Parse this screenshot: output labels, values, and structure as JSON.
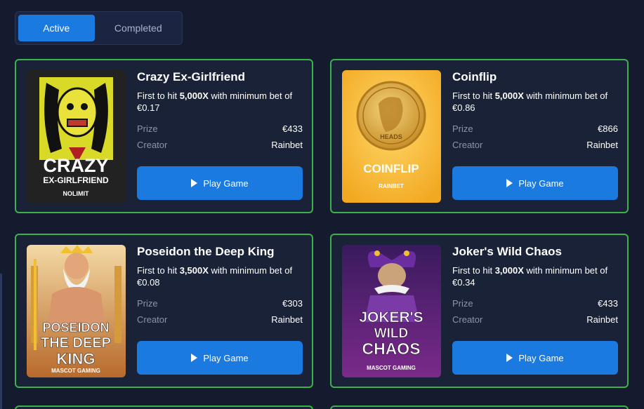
{
  "tabs": {
    "active": "Active",
    "completed": "Completed"
  },
  "labels": {
    "prize": "Prize",
    "creator": "Creator",
    "play": "Play Game"
  },
  "colors": {
    "accent": "#1a7ae0",
    "card_border": "#3db24a",
    "background": "#141b2e",
    "card_bg": "#1a2238"
  },
  "cards": [
    {
      "title": "Crazy Ex-Girlfriend",
      "desc_pre": "First to hit ",
      "multiplier": "5,000X",
      "desc_mid": " with minimum bet of ",
      "min_bet": "€0.17",
      "prize": "€433",
      "creator": "Rainbet",
      "thumb": {
        "line1": "CRAZY",
        "line2": "EX-GIRLFRIEND",
        "provider": "NOLIMIT"
      }
    },
    {
      "title": "Coinflip",
      "desc_pre": "First to hit ",
      "multiplier": "5,000X",
      "desc_mid": " with minimum bet of ",
      "min_bet": "€0.86",
      "prize": "€866",
      "creator": "Rainbet",
      "thumb": {
        "line1": "COINFLIP",
        "coin_text": "HEADS",
        "provider": "RAINBET"
      }
    },
    {
      "title": "Poseidon the Deep King",
      "desc_pre": "First to hit ",
      "multiplier": "3,500X",
      "desc_mid": " with minimum bet of ",
      "min_bet": "€0.08",
      "prize": "€303",
      "creator": "Rainbet",
      "thumb": {
        "line1": "POSEIDON",
        "line2": "THE DEEP",
        "line3": "KING",
        "provider": "MASCOT GAMING"
      }
    },
    {
      "title": "Joker's Wild Chaos",
      "desc_pre": "First to hit ",
      "multiplier": "3,000X",
      "desc_mid": " with minimum bet of ",
      "min_bet": "€0.34",
      "prize": "€433",
      "creator": "Rainbet",
      "thumb": {
        "line1": "JOKER'S",
        "line2": "WILD",
        "line3": "CHAOS",
        "provider": "MASCOT GAMING"
      }
    }
  ]
}
